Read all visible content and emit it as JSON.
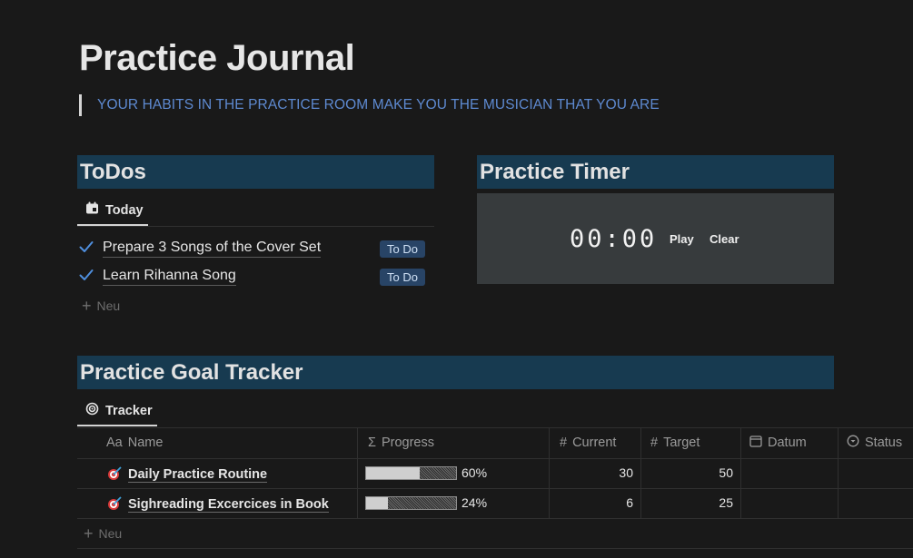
{
  "page": {
    "title": "Practice Journal",
    "quote": "YOUR HABITS IN THE PRACTICE ROOM MAKE YOU THE MUSICIAN THAT YOU ARE"
  },
  "todos": {
    "heading": "ToDos",
    "tab_label": "Today",
    "tab_icon": "calendar-icon",
    "items": [
      {
        "label": "Prepare 3 Songs of the Cover Set",
        "status": "To Do",
        "done": true
      },
      {
        "label": "Learn Rihanna Song",
        "status": "To Do",
        "done": true
      }
    ],
    "new_label": "Neu"
  },
  "timer": {
    "heading": "Practice Timer",
    "display": "00:00",
    "play_label": "Play",
    "clear_label": "Clear"
  },
  "tracker": {
    "heading": "Practice Goal Tracker",
    "tab_label": "Tracker",
    "tab_icon": "target-icon",
    "columns": [
      {
        "icon_text": "Aa",
        "label": "Name"
      },
      {
        "icon_text": "Σ",
        "label": "Progress"
      },
      {
        "icon_text": "#",
        "label": "Current"
      },
      {
        "icon_text": "#",
        "label": "Target"
      },
      {
        "icon_text": "",
        "label": "Datum"
      },
      {
        "icon_text": "",
        "label": "Status"
      }
    ],
    "rows": [
      {
        "name": "Daily Practice Routine",
        "progress": 0.6,
        "progress_text": "60%",
        "current": "30",
        "target": "50"
      },
      {
        "name": "Sighreading Excercices in Book",
        "progress": 0.24,
        "progress_text": "24%",
        "current": "6",
        "target": "25"
      }
    ],
    "new_label": "Neu"
  },
  "colors": {
    "background": "#191919",
    "section_header": "#173a50",
    "quote_text": "#5e8ad1",
    "badge_bg": "#284466",
    "check": "#4f8fde"
  }
}
